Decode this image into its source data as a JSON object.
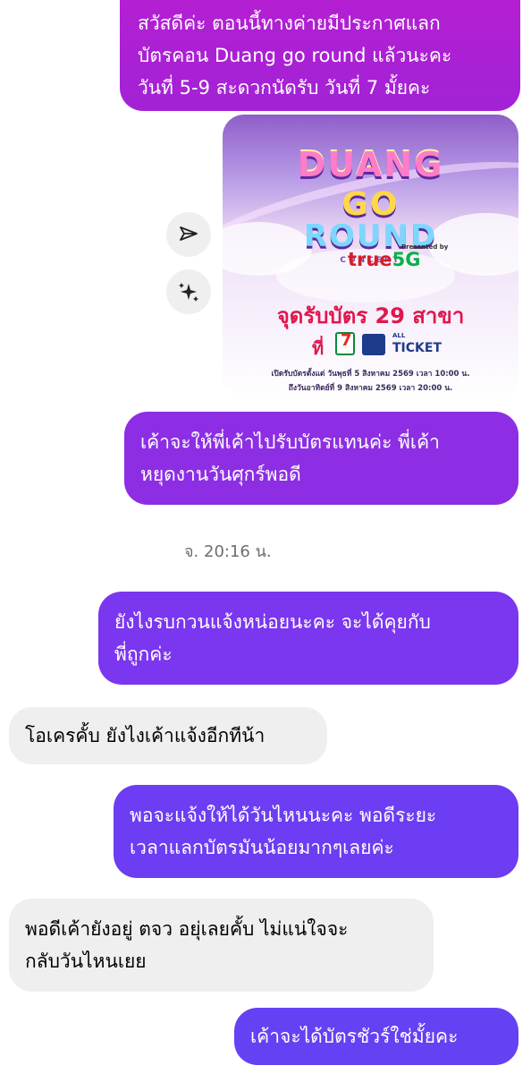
{
  "messages": [
    {
      "id": "m1",
      "direction": "outgoing",
      "lines": [
        "สวัสดีค่ะ ตอนนี้ทางค่ายมีประกาศแลก",
        "บัตรคอน Duang go round แล้วนะคะ",
        "วันที่ 5-9 สะดวกนัดรับ วันที่ 7 มั้ยคะ"
      ]
    },
    {
      "id": "m2",
      "direction": "outgoing",
      "lines": [
        "เค้าจะให้พี่เค้าไปรับบัตรแทนค่ะ พี่เค้า",
        "หยุดงานวันศุกร์พอดี"
      ]
    },
    {
      "id": "m3",
      "direction": "outgoing",
      "lines": [
        "ยังไงรบกวนแจ้งหน่อยนะคะ จะได้คุยกับ",
        "พี่ถูกค่ะ"
      ]
    },
    {
      "id": "m4",
      "direction": "incoming",
      "lines": [
        "โอเครคั้บ ยังไงเค้าแจ้งอีกทีน้า"
      ]
    },
    {
      "id": "m5",
      "direction": "outgoing",
      "lines": [
        "พอจะแจ้งให้ได้วันไหนนะคะ พอดีระยะ",
        "เวลาแลกบัตรมันน้อยมากๆเลยค่ะ"
      ]
    },
    {
      "id": "m6",
      "direction": "incoming",
      "lines": [
        "พอดีเค้ายังอยู่ ตจว อยุ่เลยคั้บ ไม่แน่ใจจะ",
        "กลับวันไหนเยย"
      ]
    },
    {
      "id": "m7",
      "direction": "outgoing",
      "lines": [
        "เค้าจะได้บัตรชัวร์ใช่มั้ยคะ"
      ]
    }
  ],
  "timestamp": "จ. 20:16 น.",
  "poster": {
    "logo_duang": "DUANG",
    "logo_go": "GO",
    "logo_round": "ROUND",
    "logo_concert": "CONCERT",
    "presented_by": "Presented by",
    "sponsor_true": "true",
    "sponsor_5g": "5G",
    "title": "จุดรับบัตร 29 สาขา",
    "at_label": "ที่",
    "all_label": "ALL",
    "ticket_label": "TICKET",
    "line1": "เปิดรับบัตรตั้งแต่ วันพุธที่ 5 สิงหาคม 2569 เวลา 10:00 น.",
    "line2": "ถึงวันอาทิตย์ที่ 9 สิงหาคม 2569 เวลา 20:00 น."
  },
  "icons": {
    "share": "share-icon",
    "ai": "sparkle-icon"
  },
  "colors": {
    "outgoing_top": "#b41fd2",
    "outgoing_bottom": "#6541f4",
    "incoming": "#efefef",
    "poster_title": "#e0174d"
  }
}
